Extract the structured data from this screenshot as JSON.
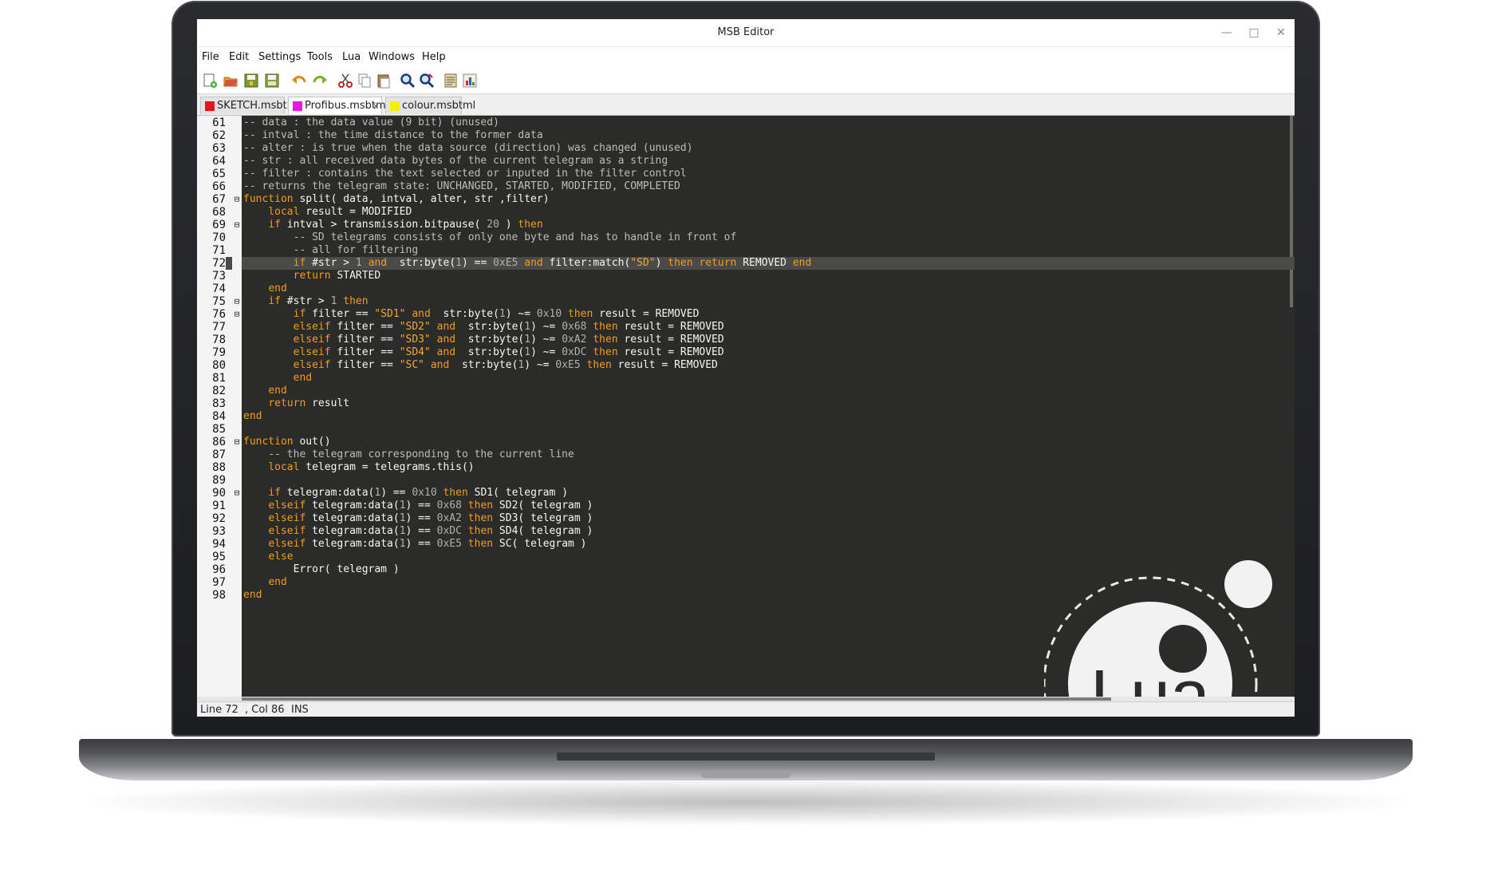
{
  "window": {
    "title": "MSB Editor",
    "minimize": "—",
    "maximize": "□",
    "close": "✕"
  },
  "menu": [
    "File",
    "Edit",
    "Settings",
    "Tools",
    "Lua",
    "Windows",
    "Help"
  ],
  "toolbar_icons": [
    "new-file-icon",
    "open-folder-icon",
    "save-icon",
    "save-all-icon",
    "undo-icon",
    "redo-icon",
    "cut-icon",
    "copy-icon",
    "paste-icon",
    "find-icon",
    "replace-icon",
    "notes-icon",
    "chart-icon"
  ],
  "tabs": [
    {
      "label": "SKETCH.msbtml",
      "color": "#e8141c",
      "active": false
    },
    {
      "label": "Profibus.msbtml",
      "color": "#e818e0",
      "active": true,
      "close": "x"
    },
    {
      "label": "colour.msbtml",
      "color": "#f5ef00",
      "active": false
    }
  ],
  "editor": {
    "highlight_line": 72,
    "lines": [
      {
        "n": "61",
        "fold": "",
        "segs": [
          [
            "c",
            "-- data : the data value (9 bit) (unused)"
          ]
        ]
      },
      {
        "n": "62",
        "fold": "",
        "segs": [
          [
            "c",
            "-- intval : the time distance to the former data"
          ]
        ]
      },
      {
        "n": "63",
        "fold": "",
        "segs": [
          [
            "c",
            "-- alter : is true when the data source (direction) was changed (unused)"
          ]
        ]
      },
      {
        "n": "64",
        "fold": "",
        "segs": [
          [
            "c",
            "-- str : all received data bytes of the current telegram as a string"
          ]
        ]
      },
      {
        "n": "65",
        "fold": "",
        "segs": [
          [
            "c",
            "-- filter : contains the text selected or inputed in the filter control"
          ]
        ]
      },
      {
        "n": "66",
        "fold": "",
        "segs": [
          [
            "c",
            "-- returns the telegram state: UNCHANGED, STARTED, MODIFIED, COMPLETED"
          ]
        ]
      },
      {
        "n": "67",
        "fold": "⊟",
        "segs": [
          [
            "k",
            "function"
          ],
          [
            "t",
            " split( data, intval, alter, str ,filter)"
          ]
        ]
      },
      {
        "n": "68",
        "fold": "",
        "segs": [
          [
            "t",
            "    "
          ],
          [
            "k",
            "local"
          ],
          [
            "t",
            " result = MODIFIED"
          ]
        ]
      },
      {
        "n": "69",
        "fold": "⊟",
        "segs": [
          [
            "t",
            "    "
          ],
          [
            "k",
            "if"
          ],
          [
            "t",
            " intval > transmission.bitpause( "
          ],
          [
            "n",
            "20"
          ],
          [
            "t",
            " ) "
          ],
          [
            "k",
            "then"
          ]
        ]
      },
      {
        "n": "70",
        "fold": "",
        "segs": [
          [
            "t",
            "        "
          ],
          [
            "c",
            "-- SD telegrams consists of only one byte and has to handle in front of"
          ]
        ]
      },
      {
        "n": "71",
        "fold": "",
        "segs": [
          [
            "t",
            "        "
          ],
          [
            "c",
            "-- all for filtering"
          ]
        ]
      },
      {
        "n": "72",
        "fold": "",
        "segs": [
          [
            "t",
            "        "
          ],
          [
            "k",
            "if"
          ],
          [
            "t",
            " #str > "
          ],
          [
            "n",
            "1"
          ],
          [
            "t",
            " "
          ],
          [
            "k",
            "and"
          ],
          [
            "t",
            "  str:byte("
          ],
          [
            "n",
            "1"
          ],
          [
            "t",
            ") == "
          ],
          [
            "n",
            "0xE5"
          ],
          [
            "t",
            " "
          ],
          [
            "k",
            "and"
          ],
          [
            "t",
            " filter:match("
          ],
          [
            "s",
            "\"SD\""
          ],
          [
            "t",
            ") "
          ],
          [
            "k",
            "then"
          ],
          [
            "t",
            " "
          ],
          [
            "k",
            "return"
          ],
          [
            "t",
            " REMOVED "
          ],
          [
            "k",
            "end"
          ]
        ]
      },
      {
        "n": "73",
        "fold": "",
        "segs": [
          [
            "t",
            "        "
          ],
          [
            "k",
            "return"
          ],
          [
            "t",
            " STARTED"
          ]
        ]
      },
      {
        "n": "74",
        "fold": "",
        "segs": [
          [
            "t",
            "    "
          ],
          [
            "k",
            "end"
          ]
        ]
      },
      {
        "n": "75",
        "fold": "⊟",
        "segs": [
          [
            "t",
            "    "
          ],
          [
            "k",
            "if"
          ],
          [
            "t",
            " #str > "
          ],
          [
            "n",
            "1"
          ],
          [
            "t",
            " "
          ],
          [
            "k",
            "then"
          ]
        ]
      },
      {
        "n": "76",
        "fold": "⊟",
        "segs": [
          [
            "t",
            "        "
          ],
          [
            "k",
            "if"
          ],
          [
            "t",
            " filter == "
          ],
          [
            "s",
            "\"SD1\""
          ],
          [
            "t",
            " "
          ],
          [
            "k",
            "and"
          ],
          [
            "t",
            "  str:byte("
          ],
          [
            "n",
            "1"
          ],
          [
            "t",
            ") ~= "
          ],
          [
            "n",
            "0x10"
          ],
          [
            "t",
            " "
          ],
          [
            "k",
            "then"
          ],
          [
            "t",
            " result = REMOVED"
          ]
        ]
      },
      {
        "n": "77",
        "fold": "",
        "segs": [
          [
            "t",
            "        "
          ],
          [
            "k",
            "elseif"
          ],
          [
            "t",
            " filter == "
          ],
          [
            "s",
            "\"SD2\""
          ],
          [
            "t",
            " "
          ],
          [
            "k",
            "and"
          ],
          [
            "t",
            "  str:byte("
          ],
          [
            "n",
            "1"
          ],
          [
            "t",
            ") ~= "
          ],
          [
            "n",
            "0x68"
          ],
          [
            "t",
            " "
          ],
          [
            "k",
            "then"
          ],
          [
            "t",
            " result = REMOVED"
          ]
        ]
      },
      {
        "n": "78",
        "fold": "",
        "segs": [
          [
            "t",
            "        "
          ],
          [
            "k",
            "elseif"
          ],
          [
            "t",
            " filter == "
          ],
          [
            "s",
            "\"SD3\""
          ],
          [
            "t",
            " "
          ],
          [
            "k",
            "and"
          ],
          [
            "t",
            "  str:byte("
          ],
          [
            "n",
            "1"
          ],
          [
            "t",
            ") ~= "
          ],
          [
            "n",
            "0xA2"
          ],
          [
            "t",
            " "
          ],
          [
            "k",
            "then"
          ],
          [
            "t",
            " result = REMOVED"
          ]
        ]
      },
      {
        "n": "79",
        "fold": "",
        "segs": [
          [
            "t",
            "        "
          ],
          [
            "k",
            "elseif"
          ],
          [
            "t",
            " filter == "
          ],
          [
            "s",
            "\"SD4\""
          ],
          [
            "t",
            " "
          ],
          [
            "k",
            "and"
          ],
          [
            "t",
            "  str:byte("
          ],
          [
            "n",
            "1"
          ],
          [
            "t",
            ") ~= "
          ],
          [
            "n",
            "0xDC"
          ],
          [
            "t",
            " "
          ],
          [
            "k",
            "then"
          ],
          [
            "t",
            " result = REMOVED"
          ]
        ]
      },
      {
        "n": "80",
        "fold": "",
        "segs": [
          [
            "t",
            "        "
          ],
          [
            "k",
            "elseif"
          ],
          [
            "t",
            " filter == "
          ],
          [
            "s",
            "\"SC\""
          ],
          [
            "t",
            " "
          ],
          [
            "k",
            "and"
          ],
          [
            "t",
            "  str:byte("
          ],
          [
            "n",
            "1"
          ],
          [
            "t",
            ") ~= "
          ],
          [
            "n",
            "0xE5"
          ],
          [
            "t",
            " "
          ],
          [
            "k",
            "then"
          ],
          [
            "t",
            " result = REMOVED"
          ]
        ]
      },
      {
        "n": "81",
        "fold": "",
        "segs": [
          [
            "t",
            "        "
          ],
          [
            "k",
            "end"
          ]
        ]
      },
      {
        "n": "82",
        "fold": "",
        "segs": [
          [
            "t",
            "    "
          ],
          [
            "k",
            "end"
          ]
        ]
      },
      {
        "n": "83",
        "fold": "",
        "segs": [
          [
            "t",
            "    "
          ],
          [
            "k",
            "return"
          ],
          [
            "t",
            " result"
          ]
        ]
      },
      {
        "n": "84",
        "fold": "",
        "segs": [
          [
            "k",
            "end"
          ]
        ]
      },
      {
        "n": "85",
        "fold": "",
        "segs": []
      },
      {
        "n": "86",
        "fold": "⊟",
        "segs": [
          [
            "k",
            "function"
          ],
          [
            "t",
            " out()"
          ]
        ]
      },
      {
        "n": "87",
        "fold": "",
        "segs": [
          [
            "t",
            "    "
          ],
          [
            "c",
            "-- the telegram corresponding to the current line"
          ]
        ]
      },
      {
        "n": "88",
        "fold": "",
        "segs": [
          [
            "t",
            "    "
          ],
          [
            "k",
            "local"
          ],
          [
            "t",
            " telegram = telegrams.this()"
          ]
        ]
      },
      {
        "n": "89",
        "fold": "",
        "segs": []
      },
      {
        "n": "90",
        "fold": "⊟",
        "segs": [
          [
            "t",
            "    "
          ],
          [
            "k",
            "if"
          ],
          [
            "t",
            " telegram:data("
          ],
          [
            "n",
            "1"
          ],
          [
            "t",
            ") == "
          ],
          [
            "n",
            "0x10"
          ],
          [
            "t",
            " "
          ],
          [
            "k",
            "then"
          ],
          [
            "t",
            " SD1( telegram )"
          ]
        ]
      },
      {
        "n": "91",
        "fold": "",
        "segs": [
          [
            "t",
            "    "
          ],
          [
            "k",
            "elseif"
          ],
          [
            "t",
            " telegram:data("
          ],
          [
            "n",
            "1"
          ],
          [
            "t",
            ") == "
          ],
          [
            "n",
            "0x68"
          ],
          [
            "t",
            " "
          ],
          [
            "k",
            "then"
          ],
          [
            "t",
            " SD2( telegram )"
          ]
        ]
      },
      {
        "n": "92",
        "fold": "",
        "segs": [
          [
            "t",
            "    "
          ],
          [
            "k",
            "elseif"
          ],
          [
            "t",
            " telegram:data("
          ],
          [
            "n",
            "1"
          ],
          [
            "t",
            ") == "
          ],
          [
            "n",
            "0xA2"
          ],
          [
            "t",
            " "
          ],
          [
            "k",
            "then"
          ],
          [
            "t",
            " SD3( telegram )"
          ]
        ]
      },
      {
        "n": "93",
        "fold": "",
        "segs": [
          [
            "t",
            "    "
          ],
          [
            "k",
            "elseif"
          ],
          [
            "t",
            " telegram:data("
          ],
          [
            "n",
            "1"
          ],
          [
            "t",
            ") == "
          ],
          [
            "n",
            "0xDC"
          ],
          [
            "t",
            " "
          ],
          [
            "k",
            "then"
          ],
          [
            "t",
            " SD4( telegram )"
          ]
        ]
      },
      {
        "n": "94",
        "fold": "",
        "segs": [
          [
            "t",
            "    "
          ],
          [
            "k",
            "elseif"
          ],
          [
            "t",
            " telegram:data("
          ],
          [
            "n",
            "1"
          ],
          [
            "t",
            ") == "
          ],
          [
            "n",
            "0xE5"
          ],
          [
            "t",
            " "
          ],
          [
            "k",
            "then"
          ],
          [
            "t",
            " SC( telegram )"
          ]
        ]
      },
      {
        "n": "95",
        "fold": "",
        "segs": [
          [
            "t",
            "    "
          ],
          [
            "k",
            "else"
          ]
        ]
      },
      {
        "n": "96",
        "fold": "",
        "segs": [
          [
            "t",
            "        Error( telegram )"
          ]
        ]
      },
      {
        "n": "97",
        "fold": "",
        "segs": [
          [
            "t",
            "    "
          ],
          [
            "k",
            "end"
          ]
        ]
      },
      {
        "n": "98",
        "fold": "",
        "segs": [
          [
            "k",
            "end"
          ]
        ]
      }
    ]
  },
  "status": {
    "line": "Line 72",
    "col": ", Col 86",
    "mode": "INS"
  },
  "logo": {
    "text": "Lua"
  },
  "colors": {
    "editor_bg": "#2b2b29",
    "keyword": "#f39b1f",
    "comment": "#bdbdb3",
    "string": "#f2a63b"
  }
}
